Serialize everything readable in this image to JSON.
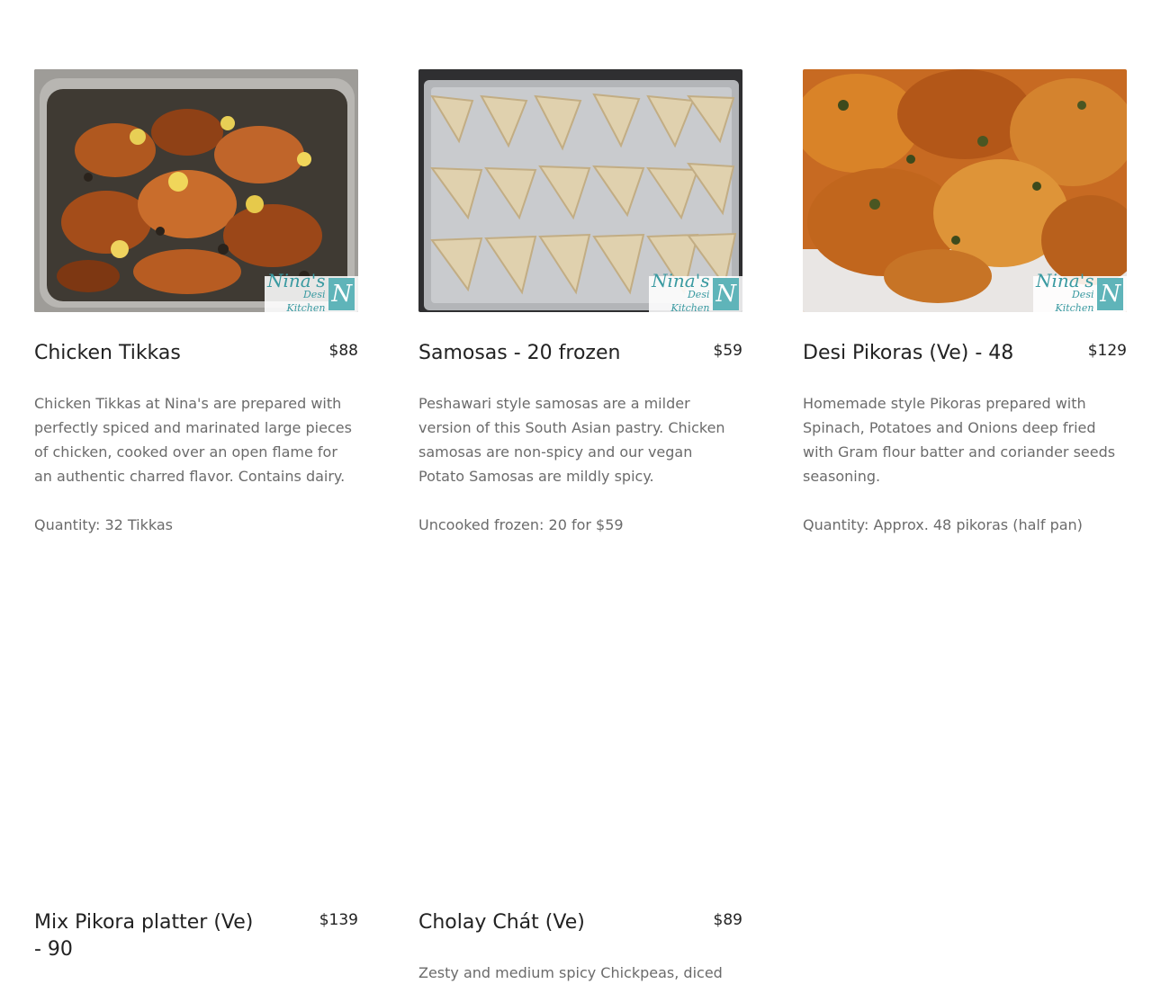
{
  "watermark": {
    "line1": "Nina's",
    "line2": "Desi Kitchen",
    "logo": "N"
  },
  "items": [
    {
      "title": "Chicken Tikkas",
      "price": "$88",
      "description": "Chicken Tikkas at Nina's are prepared with perfectly spiced and marinated large pieces of chicken, cooked over an open flame for an authentic charred flavor. Contains dairy.",
      "quantity": "Quantity: 32 Tikkas"
    },
    {
      "title": "Samosas - 20 frozen",
      "price": "$59",
      "description": "Peshawari style samosas are a milder version of this South Asian pastry. Chicken samosas are non-spicy and our vegan Potato Samosas are mildly spicy.",
      "quantity": "Uncooked frozen: 20 for $59"
    },
    {
      "title": "Desi Pikoras (Ve) - 48",
      "price": "$129",
      "description": "Homemade style Pikoras prepared with Spinach, Potatoes and Onions deep fried with Gram flour batter and coriander seeds seasoning.",
      "quantity": "Quantity: Approx. 48 pikoras (half pan)"
    },
    {
      "title": "Mix Pikora platter (Ve) - 90",
      "price": "$139"
    },
    {
      "title": "Cholay Chát (Ve)",
      "price": "$89",
      "description": "Zesty and medium spicy Chickpeas, diced"
    }
  ]
}
